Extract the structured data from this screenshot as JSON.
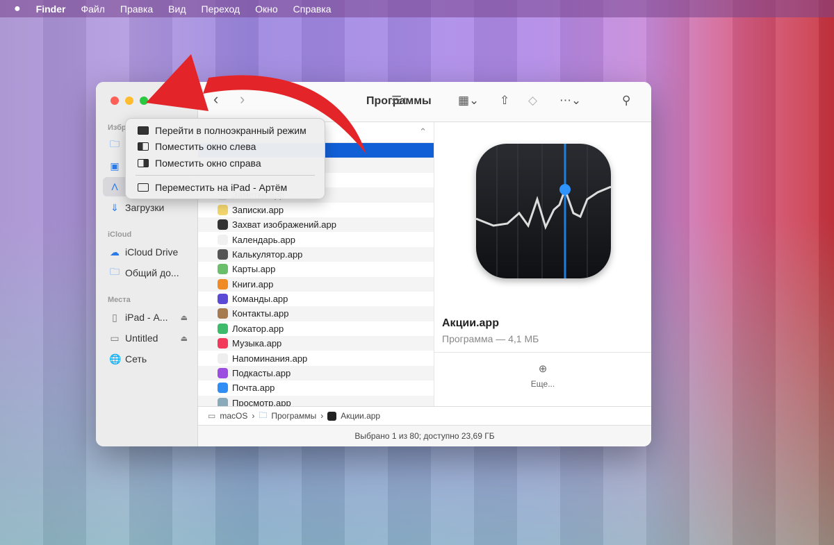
{
  "menubar": {
    "apple": "",
    "items": [
      "Finder",
      "Файл",
      "Правка",
      "Вид",
      "Переход",
      "Окно",
      "Справка"
    ]
  },
  "window": {
    "title": "Программы"
  },
  "sidebar": {
    "sections": [
      {
        "header": "Избранное",
        "items": [
          {
            "label": "",
            "icon": "folder-icon"
          },
          {
            "label": "",
            "icon": "desktop-icon"
          },
          {
            "label": "",
            "icon": "applications-icon",
            "selected": true
          },
          {
            "label": "Загрузки",
            "icon": "downloads-icon"
          }
        ]
      },
      {
        "header": "iCloud",
        "items": [
          {
            "label": "iCloud Drive",
            "icon": "cloud-icon"
          },
          {
            "label": "Общий до...",
            "icon": "shared-folder-icon"
          }
        ]
      },
      {
        "header": "Места",
        "items": [
          {
            "label": "iPad - А...",
            "icon": "ipad-icon",
            "eject": true
          },
          {
            "label": "Untitled",
            "icon": "disk-icon",
            "eject": true
          },
          {
            "label": "Сеть",
            "icon": "network-icon"
          }
        ]
      }
    ]
  },
  "context_menu": {
    "items": [
      "Перейти в полноэкранный режим",
      "Поместить окно слева",
      "Поместить окно справа",
      "Переместить на iPad - Артём"
    ]
  },
  "files": [
    {
      "name": "Заметки.app",
      "color": "#d8d8d8"
    },
    {
      "name": "Записки.app",
      "color": "#f5d76e"
    },
    {
      "name": "Захват изображений.app",
      "color": "#333"
    },
    {
      "name": "Календарь.app",
      "color": "#f0f0f0"
    },
    {
      "name": "Калькулятор.app",
      "color": "#555"
    },
    {
      "name": "Карты.app",
      "color": "#6bbf6a"
    },
    {
      "name": "Книги.app",
      "color": "#f08a24"
    },
    {
      "name": "Команды.app",
      "color": "#5b4ad6"
    },
    {
      "name": "Контакты.app",
      "color": "#a57b4f"
    },
    {
      "name": "Локатор.app",
      "color": "#3dbb6b"
    },
    {
      "name": "Музыка.app",
      "color": "#f2395a"
    },
    {
      "name": "Напоминания.app",
      "color": "#eee"
    },
    {
      "name": "Подкасты.app",
      "color": "#9c4ee0"
    },
    {
      "name": "Почта.app",
      "color": "#2f8df5"
    },
    {
      "name": "Просмотр.app",
      "color": "#8ab"
    }
  ],
  "preview": {
    "name": "Акции.app",
    "kind": "Программа — 4,1 МБ",
    "more": "Еще..."
  },
  "pathbar": [
    "macOS",
    "Программы",
    "Акции.app"
  ],
  "status": "Выбрано 1 из 80; доступно 23,69 ГБ"
}
